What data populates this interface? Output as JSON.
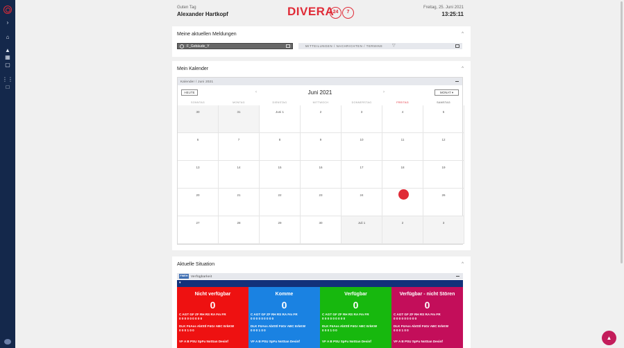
{
  "header": {
    "greeting": "Guten Tag",
    "user_name": "Alexander Hartkopf",
    "brand": "DIVERA",
    "brand_circle_1": "24",
    "brand_circle_2": "7",
    "date": "Freitag, 25. Juni 2021",
    "time": "13:25:11"
  },
  "sidebar": {
    "icons": [
      "logo-icon",
      "expand-icon",
      "home-icon",
      "alarm-icon",
      "dashboard-icon",
      "monitor-icon",
      "group-icon",
      "chat-icon",
      "avatar"
    ]
  },
  "meldungen": {
    "title": "Meine aktuellen Meldungen",
    "tag_label": "F_Gebäude_Y",
    "filter_text": "MITTEILUNGEN  /  NACHRICHTEN  /  TERMINE"
  },
  "kalender": {
    "title": "Mein Kalender",
    "breadcrumb": "Kalender / Juni 2021",
    "today_button": "HEUTE",
    "month_label": "Juni 2021",
    "view_button": "MONAT",
    "weekdays": [
      "SONNTAG",
      "MONTAG",
      "DIENSTAG",
      "MITTWOCH",
      "DONNERSTAG",
      "FREITAG",
      "SAMSTAG"
    ],
    "weeks": [
      [
        "30",
        "31",
        "Juni 1",
        "2",
        "3",
        "4",
        "5"
      ],
      [
        "6",
        "7",
        "8",
        "9",
        "10",
        "11",
        "12"
      ],
      [
        "13",
        "14",
        "15",
        "16",
        "17",
        "18",
        "19"
      ],
      [
        "20",
        "21",
        "22",
        "23",
        "24",
        "25",
        "26"
      ],
      [
        "27",
        "28",
        "29",
        "30",
        "Juli 1",
        "2",
        "3"
      ]
    ]
  },
  "situation": {
    "title": "Aktuelle Situation",
    "badge": "FWEH",
    "subtitle": "Verfügbarkeit",
    "columns": [
      {
        "title": "Nicht verfügbar",
        "count": "0",
        "color": "#ee1111"
      },
      {
        "title": "Komme",
        "count": "0",
        "color": "#1a82e2"
      },
      {
        "title": "Verfügbar",
        "count": "0",
        "color": "#17b80e"
      },
      {
        "title": "Verfügbar - nicht Stören",
        "count": "0",
        "color": "#c30e5a"
      }
    ],
    "row1_labels": "C  AGT  GF  ZF  RH  RS  RA  Fm  FR",
    "row1_values": "0    0    0    0    0    0    0    0    0",
    "row2_labels": "DLK  FüAss  AbtStl  FüGr  ABC  ErkKW",
    "row2_values": "0      0      0      1     0      0",
    "row3_labels": "VF  A  B  PSU  SpFu  NotSan  Desinf"
  },
  "fab_icon": "alarm-icon"
}
